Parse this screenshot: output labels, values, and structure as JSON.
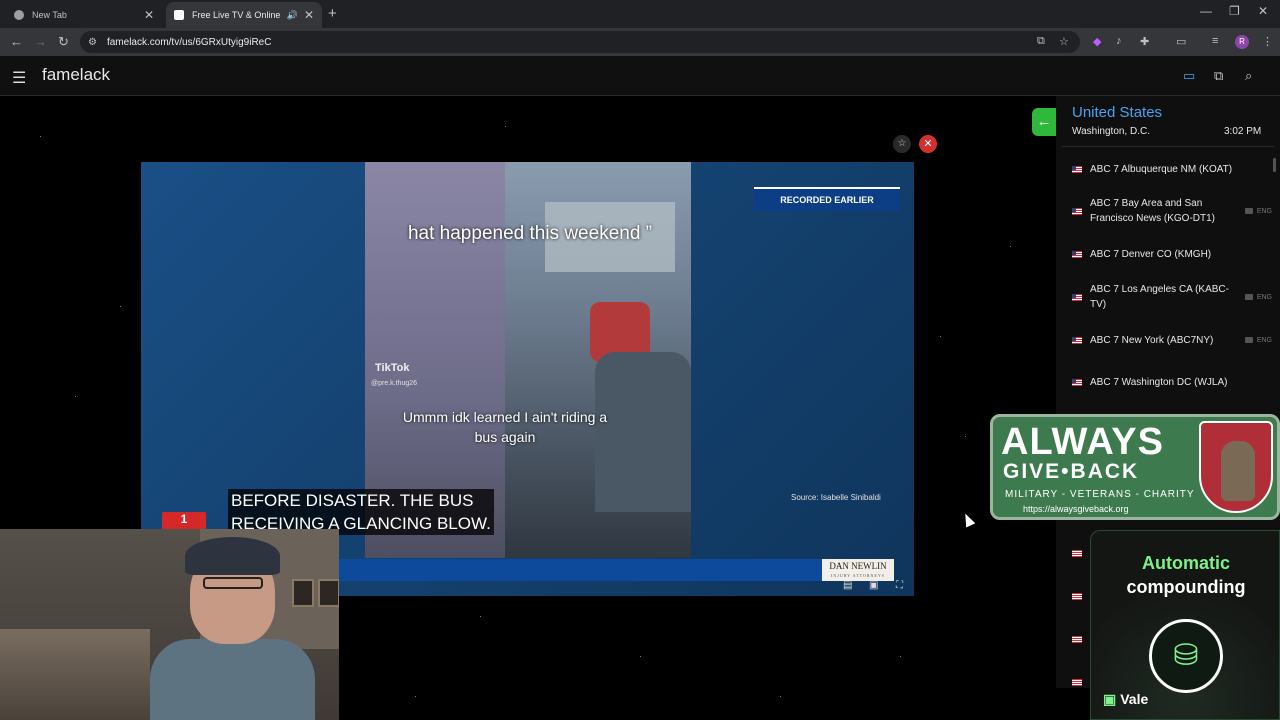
{
  "browser": {
    "tabs": [
      {
        "title": "New Tab"
      },
      {
        "title": "Free Live TV & Online Radio"
      }
    ],
    "address": "famelack.com/tv/us/6GRxUtyig9iReC",
    "profile_initial": "R"
  },
  "app": {
    "brand": "famelack"
  },
  "player": {
    "clip_caption_top": "hat happened this weekend ”",
    "tiktok_label": "TikTok",
    "tiktok_handle": "@pre.k.thug26",
    "clip_caption_bottom": "Ummm idk learned I ain't riding a bus again",
    "recorded_badge": "RECORDED EARLIER",
    "source_credit": "Source: Isabelle Sinibaldi",
    "subtitle_line1": "BEFORE DISASTER. THE BUS",
    "subtitle_line2": "RECEIVING A GLANCING BLOW.",
    "ticker_brand": "DAN NEWLIN",
    "ticker_brand_sub": "INJURY ATTORNEYS"
  },
  "sidebar": {
    "country": "United States",
    "city": "Washington, D.C.",
    "time": "3:02 PM",
    "channels": [
      {
        "name": "ABC 7 Albuquerque NM (KOAT)",
        "lang": ""
      },
      {
        "name": "ABC 7 Bay Area and San Francisco News (KGO-DT1)",
        "lang": "ENG"
      },
      {
        "name": "ABC 7 Denver CO (KMGH)",
        "lang": ""
      },
      {
        "name": "ABC 7 Los Angeles CA (KABC-TV)",
        "lang": "ENG"
      },
      {
        "name": "ABC 7 New York (ABC7NY)",
        "lang": "ENG"
      },
      {
        "name": "ABC 7 Washington DC (WJLA)",
        "lang": ""
      }
    ]
  },
  "ads": {
    "ad1": {
      "headline": "ALWAYS",
      "subline": "GIVE•BACK",
      "tagline": "MILITARY - VETERANS - CHARITY",
      "url": "https://alwaysgiveback.org"
    },
    "ad2": {
      "line1": "Automatic",
      "line2": "compounding",
      "brand": "Vale"
    }
  },
  "colors": {
    "accent_blue": "#4aa3f2",
    "back_green": "#2eb83c",
    "close_red": "#d32f2f"
  }
}
